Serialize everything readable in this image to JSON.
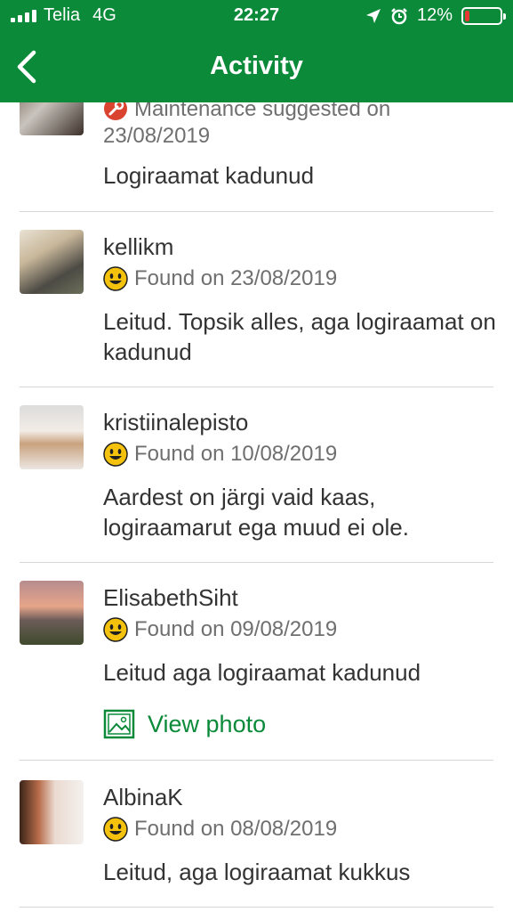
{
  "status_bar": {
    "carrier": "Telia",
    "network": "4G",
    "time": "22:27",
    "battery": "12%",
    "battery_level": 0.12,
    "battery_color": "#e53935"
  },
  "header": {
    "title": "Activity",
    "back_icon": "chevron-left-icon",
    "color": "#0b8a3a"
  },
  "entries": [
    {
      "status": "Maintenance suggested on",
      "date": "23/08/2019",
      "status_icon": "wrench-icon",
      "message": "Logiraamat kadunud"
    },
    {
      "user": "kellikm",
      "status": "Found on 23/08/2019",
      "status_icon": "smiley-icon",
      "message": "Leitud. Topsik alles, aga logiraamat on kadunud"
    },
    {
      "user": "kristiinalepisto",
      "status": "Found on 10/08/2019",
      "status_icon": "smiley-icon",
      "message": "Aardest on järgi vaid kaas, logiraamarut ega muud ei ole."
    },
    {
      "user": "ElisabethSiht",
      "status": "Found on 09/08/2019",
      "status_icon": "smiley-icon",
      "message": "Leitud aga logiraamat kadunud",
      "link": "View photo",
      "link_icon": "image-icon"
    },
    {
      "user": "AlbinaK",
      "status": "Found on 08/08/2019",
      "status_icon": "smiley-icon",
      "message": "Leitud, aga logiraamat kukkus"
    }
  ]
}
